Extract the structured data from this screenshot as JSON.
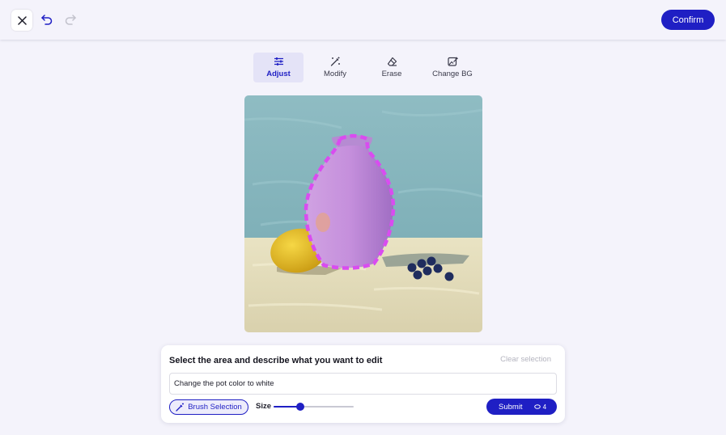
{
  "toolbar": {
    "close_icon": "close-icon",
    "undo_icon": "undo-icon",
    "redo_icon": "redo-icon",
    "confirm_label": "Confirm"
  },
  "tabs": [
    {
      "label": "Adjust",
      "icon": "sliders-icon",
      "active": true
    },
    {
      "label": "Modify",
      "icon": "magic-wand-icon",
      "active": false
    },
    {
      "label": "Erase",
      "icon": "eraser-icon",
      "active": false
    },
    {
      "label": "Change BG",
      "icon": "image-edit-icon",
      "active": false
    }
  ],
  "canvas": {
    "image": "still-life painting of a purple vase, lemon and blueberries",
    "selection_color": "#d94cf0"
  },
  "panel": {
    "title": "Select the area and describe what you want to edit",
    "clear_label": "Clear selection",
    "prompt_value": "Change the pot color to white",
    "brush_label": "Brush Selection",
    "size_label": "Size",
    "size_value": 0.33,
    "submit_label": "Submit",
    "credits": "4"
  },
  "colors": {
    "accent": "#1f1fc4",
    "background": "#f4f3fb"
  }
}
